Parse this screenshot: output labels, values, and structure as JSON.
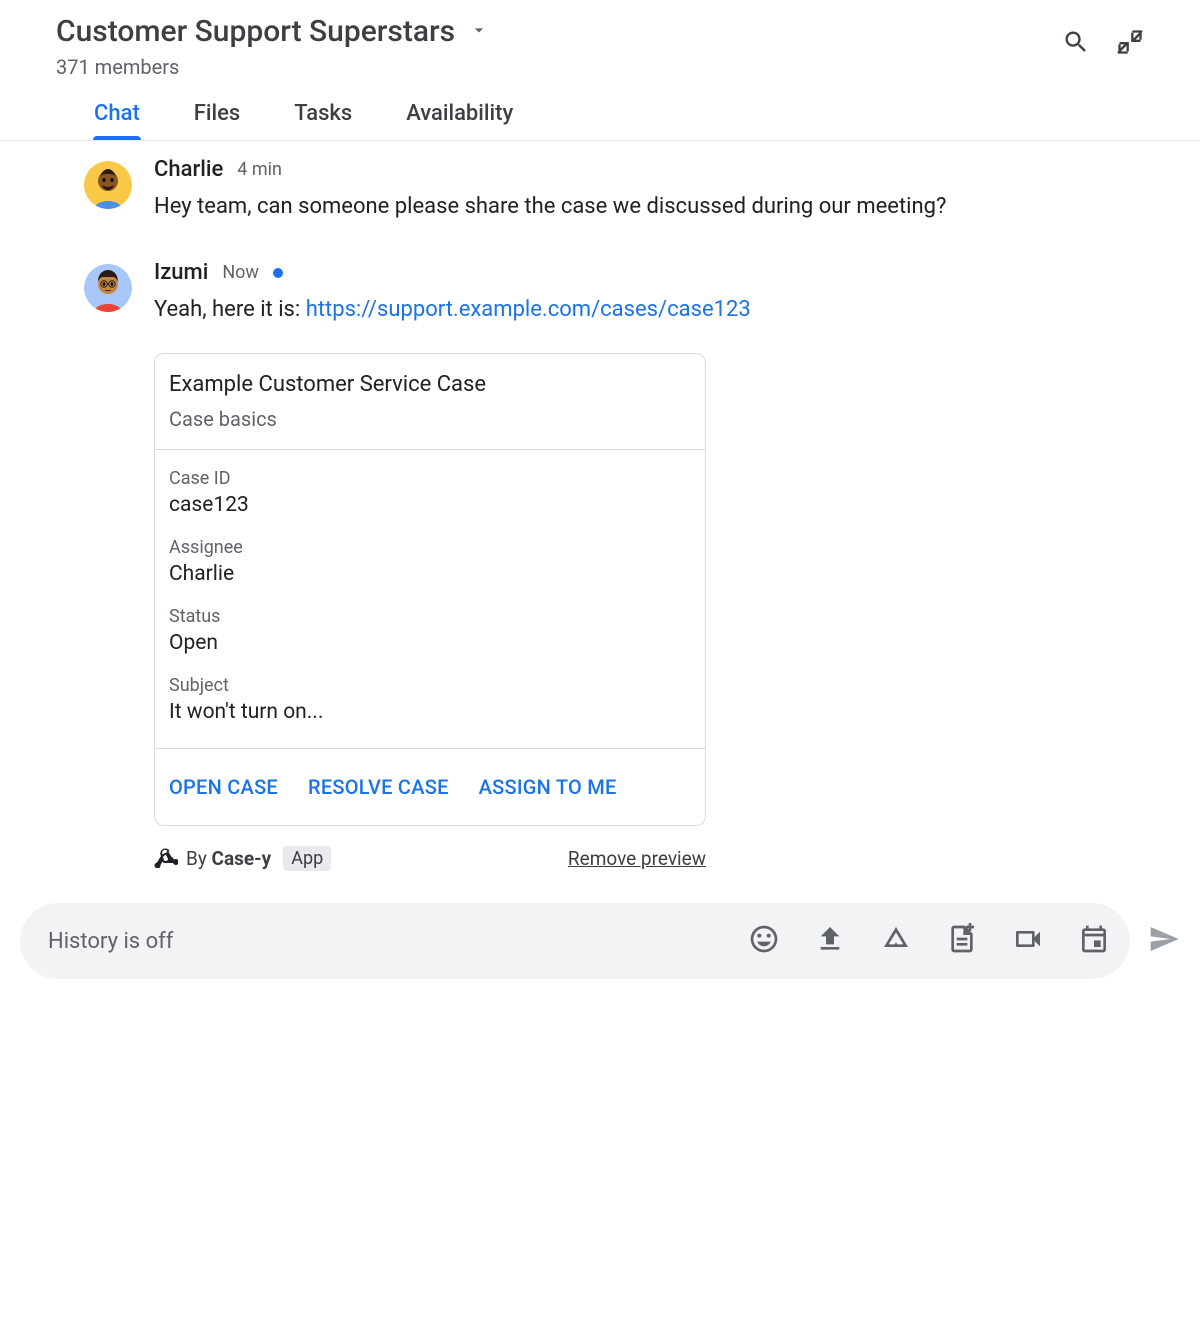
{
  "header": {
    "title": "Customer Support Superstars",
    "members": "371 members"
  },
  "tabs": [
    "Chat",
    "Files",
    "Tasks",
    "Availability"
  ],
  "messages": [
    {
      "author": "Charlie",
      "time": "4 min",
      "text": "Hey team, can someone please share the case we discussed during our meeting?"
    },
    {
      "author": "Izumi",
      "time": "Now",
      "text_prefix": "Yeah, here it is: ",
      "link": "https://support.example.com/cases/case123"
    }
  ],
  "card": {
    "title": "Example Customer Service Case",
    "subtitle": "Case basics",
    "fields": [
      {
        "label": "Case ID",
        "value": "case123"
      },
      {
        "label": "Assignee",
        "value": "Charlie"
      },
      {
        "label": "Status",
        "value": "Open"
      },
      {
        "label": "Subject",
        "value": "It won't turn on..."
      }
    ],
    "actions": [
      "OPEN CASE",
      "RESOLVE CASE",
      "ASSIGN TO ME"
    ]
  },
  "preview": {
    "by_prefix": "By ",
    "app_name": "Case-y",
    "badge": "App",
    "remove": "Remove preview"
  },
  "composer": {
    "placeholder": "History is off"
  }
}
